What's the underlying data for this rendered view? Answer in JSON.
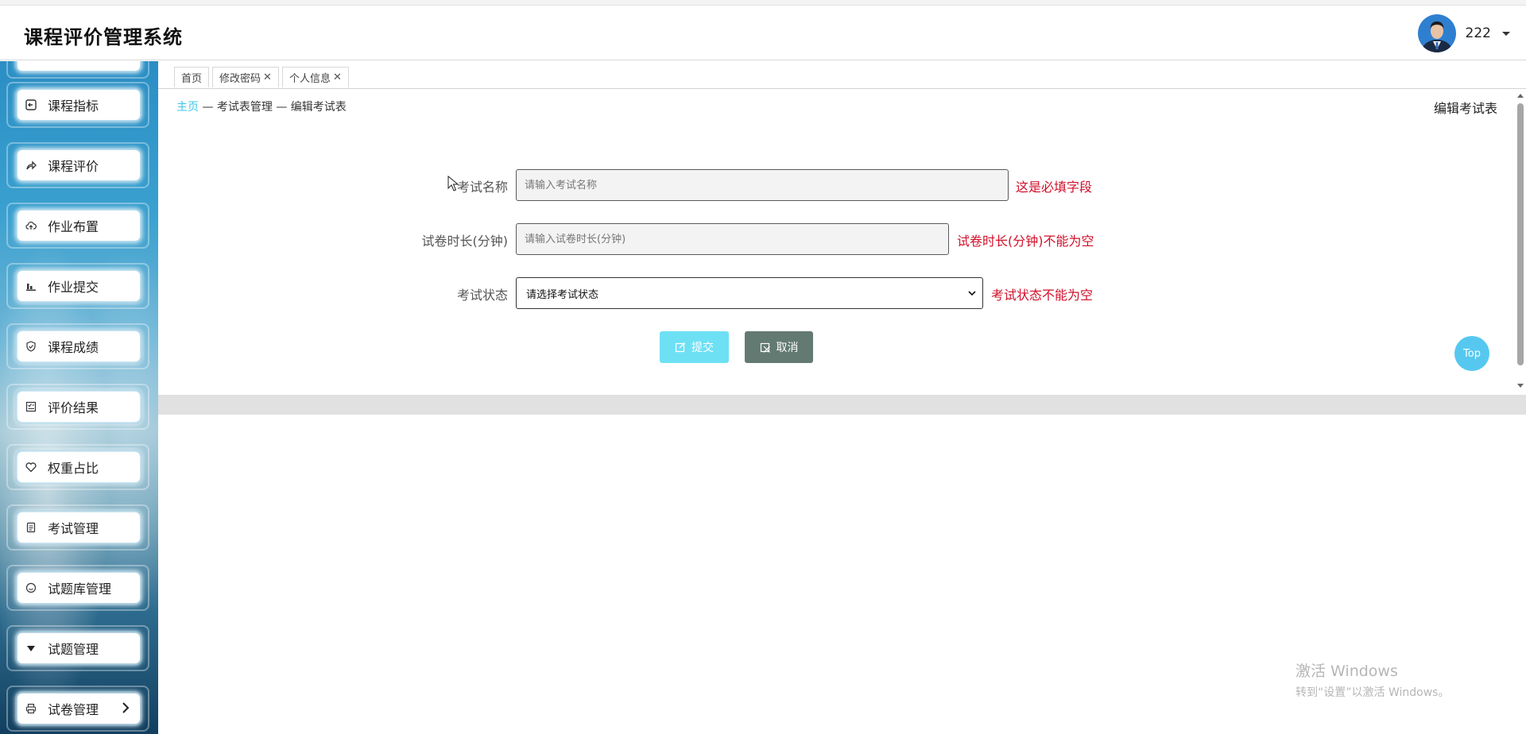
{
  "app": {
    "title": "课程评价管理系统"
  },
  "user": {
    "name": "222"
  },
  "sidebar": {
    "items": [
      {
        "label": "课程指标",
        "icon": "exit-icon"
      },
      {
        "label": "课程评价",
        "icon": "share-icon"
      },
      {
        "label": "作业布置",
        "icon": "cloud-upload-icon"
      },
      {
        "label": "作业提交",
        "icon": "bar-chart-icon"
      },
      {
        "label": "课程成绩",
        "icon": "shield-check-icon"
      },
      {
        "label": "评价结果",
        "icon": "checklist-icon"
      },
      {
        "label": "权重占比",
        "icon": "heart-icon"
      },
      {
        "label": "考试管理",
        "icon": "document-icon"
      },
      {
        "label": "试题库管理",
        "icon": "smile-icon"
      },
      {
        "label": "试题管理",
        "icon": "triangle-down-icon"
      },
      {
        "label": "试卷管理",
        "icon": "print-icon"
      }
    ]
  },
  "tabs": [
    {
      "label": "首页",
      "closable": false
    },
    {
      "label": "修改密码",
      "closable": true
    },
    {
      "label": "个人信息",
      "closable": true
    }
  ],
  "tab_close_glyph": "✕",
  "breadcrumb": {
    "home": "主页",
    "section": "— 考试表管理 — 编辑考试表"
  },
  "page_heading": "编辑考试表",
  "form": {
    "exam_name": {
      "label": "考试名称",
      "placeholder": "请输入考试名称",
      "error": "这是必填字段"
    },
    "duration": {
      "label": "试卷时长(分钟)",
      "placeholder": "请输入试卷时长(分钟)",
      "error": "试卷时长(分钟)不能为空"
    },
    "status": {
      "label": "考试状态",
      "selected": "请选择考试状态",
      "error": "考试状态不能为空"
    }
  },
  "buttons": {
    "submit": "提交",
    "cancel": "取消"
  },
  "top_button": "Top",
  "watermark": {
    "line1": "激活 Windows",
    "line2": "转到“设置”以激活 Windows。"
  },
  "colors": {
    "accent": "#3cc7e8",
    "error": "#d0102a",
    "submit": "#6ee0f4",
    "cancel": "#637a72"
  }
}
